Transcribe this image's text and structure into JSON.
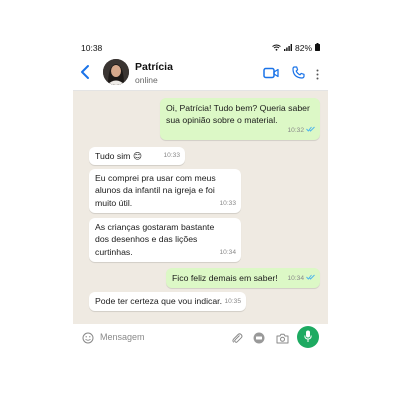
{
  "status_bar": {
    "time": "10:38",
    "battery": "82%"
  },
  "contact": {
    "name": "Patrícia",
    "status": "online"
  },
  "messages": [
    {
      "direction": "out",
      "text": "Oi, Patrícia! Tudo bem? Queria saber sua opinião sobre o material.",
      "time": "10:32",
      "read": true
    },
    {
      "direction": "in",
      "text": "Tudo sim 😊",
      "time": "10:33"
    },
    {
      "direction": "in",
      "text": "Eu comprei pra usar com meus alunos da infantil na igreja e foi muito útil.",
      "time": "10:33"
    },
    {
      "direction": "in",
      "text": "As crianças gostaram bastante dos desenhos e das lições curtinhas.",
      "time": "10:34"
    },
    {
      "direction": "out",
      "text": "Fico feliz demais em saber!",
      "time": "10:34",
      "read": true
    },
    {
      "direction": "in",
      "text": "Pode ter certeza que vou indicar.",
      "time": "10:35"
    }
  ],
  "input": {
    "placeholder": "Mensagem"
  },
  "colors": {
    "accent": "#1daa61",
    "outgoing_bubble": "#dcf8c6",
    "chat_background": "#efeae2",
    "read_ticks": "#4fb6ec"
  }
}
